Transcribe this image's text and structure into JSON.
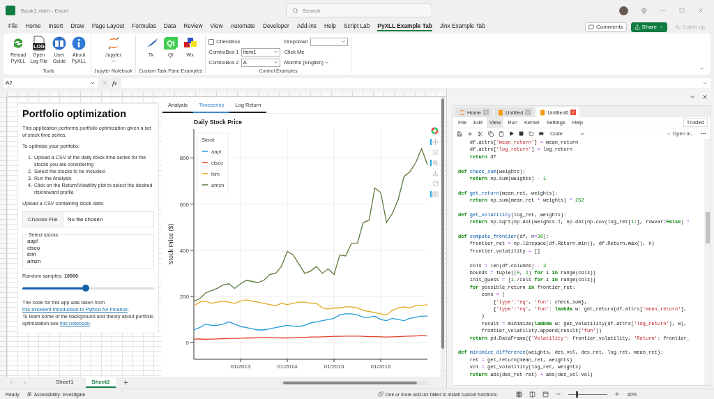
{
  "window": {
    "title": "Book1.xlsm  -  Excel"
  },
  "search": {
    "placeholder": "Search"
  },
  "ribbon_tabs": [
    {
      "label": "File",
      "selected": false
    },
    {
      "label": "Home",
      "selected": false
    },
    {
      "label": "Insert",
      "selected": false
    },
    {
      "label": "Draw",
      "selected": false
    },
    {
      "label": "Page Layout",
      "selected": false
    },
    {
      "label": "Formulas",
      "selected": false
    },
    {
      "label": "Data",
      "selected": false
    },
    {
      "label": "Review",
      "selected": false
    },
    {
      "label": "View",
      "selected": false
    },
    {
      "label": "Automate",
      "selected": false
    },
    {
      "label": "Developer",
      "selected": false
    },
    {
      "label": "Add-ins",
      "selected": false
    },
    {
      "label": "Help",
      "selected": false
    },
    {
      "label": "Script Lab",
      "selected": false
    },
    {
      "label": "PyXLL Example Tab",
      "selected": true
    },
    {
      "label": "Jinx Example Tab",
      "selected": false
    }
  ],
  "header_buttons": [
    {
      "label": "Comments",
      "kind": "comments",
      "disabled": false
    },
    {
      "label": "Share",
      "kind": "share",
      "disabled": false
    },
    {
      "label": "Catch up",
      "kind": "catchup",
      "disabled": true
    }
  ],
  "ribbon_groups": [
    {
      "label": "Tools",
      "kind": "buttons",
      "buttons": [
        {
          "lines": [
            "Reload",
            "PyXLL"
          ]
        },
        {
          "lines": [
            "Open",
            "Log File"
          ],
          "icon_text": "LOG"
        },
        {
          "lines": [
            "User",
            "Guide"
          ]
        },
        {
          "lines": [
            "About",
            "PyXLL"
          ]
        }
      ]
    },
    {
      "label": "Jupyter Notebook",
      "kind": "buttons",
      "buttons": [
        {
          "lines": [
            "Jupyter"
          ],
          "dropdown": true
        }
      ]
    },
    {
      "label": "Custom Task Pane Examples",
      "kind": "buttons",
      "buttons": [
        {
          "lines": [
            "Tk"
          ]
        },
        {
          "lines": [
            "Qt"
          ],
          "icon_text": "Qt"
        },
        {
          "lines": [
            "Wx"
          ]
        }
      ]
    },
    {
      "label": "Control Examples",
      "kind": "controls",
      "checkbox": {
        "label": "CheckBox",
        "checked": false
      },
      "combos": [
        {
          "label": "ComboBox 1",
          "value": "Item1"
        },
        {
          "label": "ComboBox 2",
          "value": "A"
        }
      ],
      "dropdown": {
        "label": "Dropdown"
      },
      "button": "Click Me",
      "menu": "Months (English)"
    }
  ],
  "formula_bar": {
    "cell": "A2",
    "fx": "fx"
  },
  "app": {
    "title": "Portfolio optimization",
    "intro": "This application performs portfolio optimization given a set of stock time series.",
    "subheading": "To optimize your portfolio:",
    "steps": [
      {
        "marker": "1.",
        "text": "Upload a CSV of the daily stock time series for the stocks you are considering"
      },
      {
        "marker": "2.",
        "text": "Select the stocks to be included."
      },
      {
        "marker": "3.",
        "text": "Run the Analysis"
      },
      {
        "marker": "4.",
        "text": "Click on the Return/Volatility plot to select the desired risk/reward profile"
      }
    ],
    "upload_label": "Upload a CSV containing stock data:",
    "file_button": "Choose File",
    "file_status": "No file chosen",
    "stocks_legend": "Select stocks",
    "stocks": [
      "aapl",
      "cisco",
      "ibm",
      "amzn"
    ],
    "samples": {
      "label": "Random samples: **10000**",
      "level": 0.48
    },
    "footer": [
      {
        "before": "The code for this app was taken from",
        "link": "this excellent introduction to Python for Finance",
        "after": "."
      },
      {
        "before": "To learn some of the background and theory about portfolio optimization see",
        "link": "this notebook",
        "after": "."
      }
    ],
    "tabs": [
      {
        "label": "Analysis",
        "selected": false
      },
      {
        "label": "Timeseries",
        "selected": true
      },
      {
        "label": "Log Return",
        "selected": false
      }
    ],
    "chart_data": {
      "type": "line",
      "title": "Daily Stock Price",
      "ylabel": "Stock Price ($)",
      "grid": true,
      "legend": "upper left",
      "legend_title": "Stock",
      "categories": [
        null,
        null,
        null,
        null,
        null,
        null,
        null,
        null,
        "01/2013",
        null,
        null,
        null,
        null,
        null,
        null,
        null,
        "01/2014",
        null,
        null,
        null,
        null,
        null,
        null,
        null,
        "01/2015",
        null,
        null,
        null,
        null,
        null,
        null,
        null,
        "01/2016",
        null,
        null,
        null,
        null,
        null,
        null,
        null,
        null
      ],
      "series": [
        {
          "name": "aapl",
          "color": "#1f9bd7",
          "values": [
            55,
            65,
            80,
            75,
            75,
            80,
            90,
            80,
            70,
            65,
            60,
            55,
            55,
            60,
            65,
            70,
            75,
            72,
            70,
            75,
            85,
            90,
            95,
            100,
            105,
            120,
            125,
            125,
            120,
            110,
            110,
            115,
            100,
            95,
            105,
            100,
            95,
            105,
            110,
            115,
            115
          ]
        },
        {
          "name": "cisco",
          "color": "#e0402a",
          "values": [
            15,
            16,
            14,
            15,
            16,
            17,
            18,
            18,
            19,
            20,
            20,
            21,
            22,
            22,
            21,
            20,
            20,
            21,
            22,
            23,
            24,
            24,
            25,
            26,
            27,
            27,
            28,
            28,
            28,
            27,
            26,
            26,
            25,
            24,
            25,
            26,
            27,
            28,
            29,
            30,
            29
          ]
        },
        {
          "name": "ibm",
          "color": "#e0a91c",
          "values": [
            160,
            175,
            180,
            170,
            175,
            180,
            175,
            170,
            180,
            185,
            180,
            175,
            170,
            165,
            160,
            170,
            165,
            170,
            175,
            175,
            170,
            170,
            150,
            145,
            150,
            150,
            155,
            155,
            150,
            140,
            135,
            130,
            125,
            120,
            140,
            150,
            155,
            150,
            160,
            160,
            165
          ]
        },
        {
          "name": "amzn",
          "color": "#5a7a3a",
          "values": [
            180,
            190,
            215,
            225,
            235,
            250,
            255,
            235,
            255,
            270,
            265,
            260,
            270,
            295,
            300,
            330,
            395,
            380,
            340,
            300,
            310,
            330,
            300,
            320,
            295,
            380,
            375,
            430,
            430,
            520,
            530,
            670,
            650,
            520,
            560,
            620,
            720,
            740,
            780,
            840,
            770
          ]
        }
      ],
      "ylim": [
        -72,
        925
      ],
      "yticks": [
        0,
        200,
        400,
        600,
        800
      ]
    }
  },
  "notebook": {
    "tabs": [
      {
        "label": "Home",
        "kind": "home",
        "selected": false
      },
      {
        "label": "Untitled",
        "kind": "notebook",
        "selected": false
      },
      {
        "label": "Untitled6",
        "kind": "notebook",
        "selected": true
      }
    ],
    "menu": [
      {
        "label": "File",
        "selected": false
      },
      {
        "label": "Edit",
        "selected": false
      },
      {
        "label": "View",
        "selected": true
      },
      {
        "label": "Run",
        "selected": false
      },
      {
        "label": "Kernel",
        "selected": false
      },
      {
        "label": "Settings",
        "selected": false
      },
      {
        "label": "Help",
        "selected": false
      }
    ],
    "trusted": "Trusted",
    "cell_type": "Code",
    "open_in": "Open in...",
    "code_blocks": [
      [
        "    df.attrs['mean_return'] = mean_return",
        "    df.attrs['log_return'] = log_return",
        "    return df"
      ],
      [
        "def check_sum(weights):",
        "    return np.sum(weights) - 1"
      ],
      [
        "def get_return(mean_ret, weights):",
        "    return np.sum(mean_ret * weights) * 252"
      ],
      [
        "def get_volatility(log_ret, weights):",
        "    return np.sqrt(np.dot(weights.T, np.dot(np.cov(log_ret[1:], rowvar=False) *"
      ],
      [
        "def compute_frontier(df, n=30):",
        "    frontier_ret = np.linspace(df.Return.min(), df.Return.max(), n)",
        "    frontier_volatility = []"
      ],
      [
        "    cols = len(df.columns) - 3",
        "    bounds = tuple((0, 1) for i in range(cols))",
        "    init_guess = [1./cols for i in range(cols)]",
        "    for possible_return in frontier_ret:",
        "        cons = (",
        "            {'type':'eq', 'fun': check_sum},",
        "            {'type':'eq', 'fun': lambda w: get_return(df.attrs['mean_return'],",
        "        )",
        "        result = minimize(lambda w: get_volatility(df.attrs['log_return'], w),",
        "        frontier_volatility.append(result['fun'])",
        "    return pd.DataFrame({'Volatility': frontier_volatility, 'Return': frontier_"
      ],
      [
        "def minimize_difference(weights, des_vol, des_ret, log_ret, mean_ret):",
        "    ret = get_return(mean_ret, weights)",
        "    vol = get_volatility(log_ret, weights)",
        "    return abs(des_ret-ret) + abs(des_vol-vol)"
      ]
    ]
  },
  "sheet_tabs": [
    {
      "label": "Sheet1",
      "selected": false
    },
    {
      "label": "Sheet2",
      "selected": true
    }
  ],
  "status_bar": {
    "ready": "Ready",
    "accessibility": "Accessibility: Investigate",
    "message": "One or more add-ins failed to install custom functions.",
    "zoom": "40%",
    "zoom_slider": {
      "level": 0.2
    }
  }
}
